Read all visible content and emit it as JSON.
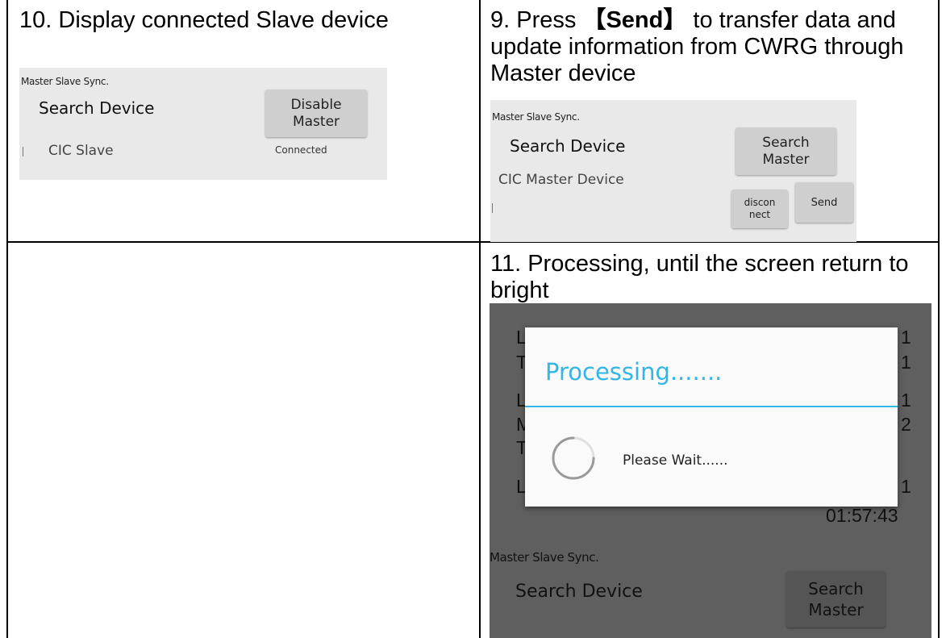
{
  "cells": {
    "step10": {
      "caption": "10. Display connected Slave device"
    },
    "step9": {
      "caption_prefix": "9. Press ",
      "caption_button": "【Send】",
      "caption_suffix": " to transfer data and update information from CWRG through Master device"
    },
    "step11": {
      "caption": "11.  Processing, until the screen return to bright"
    }
  },
  "slave_screen": {
    "header": "Master Slave Sync.",
    "title": "Search Device",
    "button_label": "Disable\nMaster",
    "device_name": "CIC Slave",
    "status": "Connected"
  },
  "master_screen": {
    "header": "Master Slave Sync.",
    "title": "Search Device",
    "search_button_label": "Search\nMaster",
    "device_name": "CIC Master Device",
    "disconnect_button_label": "discon\nnect",
    "send_button_label": "Send"
  },
  "processing_screen": {
    "dialog_title": "Processing.......",
    "dialog_message": "Please Wait......",
    "accent_color": "#33b5e5",
    "bg_left_letters": [
      "L",
      "T",
      "L",
      "M",
      "T",
      "L"
    ],
    "bg_right_digits": [
      "1",
      "1",
      "1",
      "2",
      "1"
    ],
    "bg_time": "01:57:43",
    "header": "Master Slave Sync.",
    "title": "Search Device",
    "search_button_label": "Search\nMaster"
  }
}
